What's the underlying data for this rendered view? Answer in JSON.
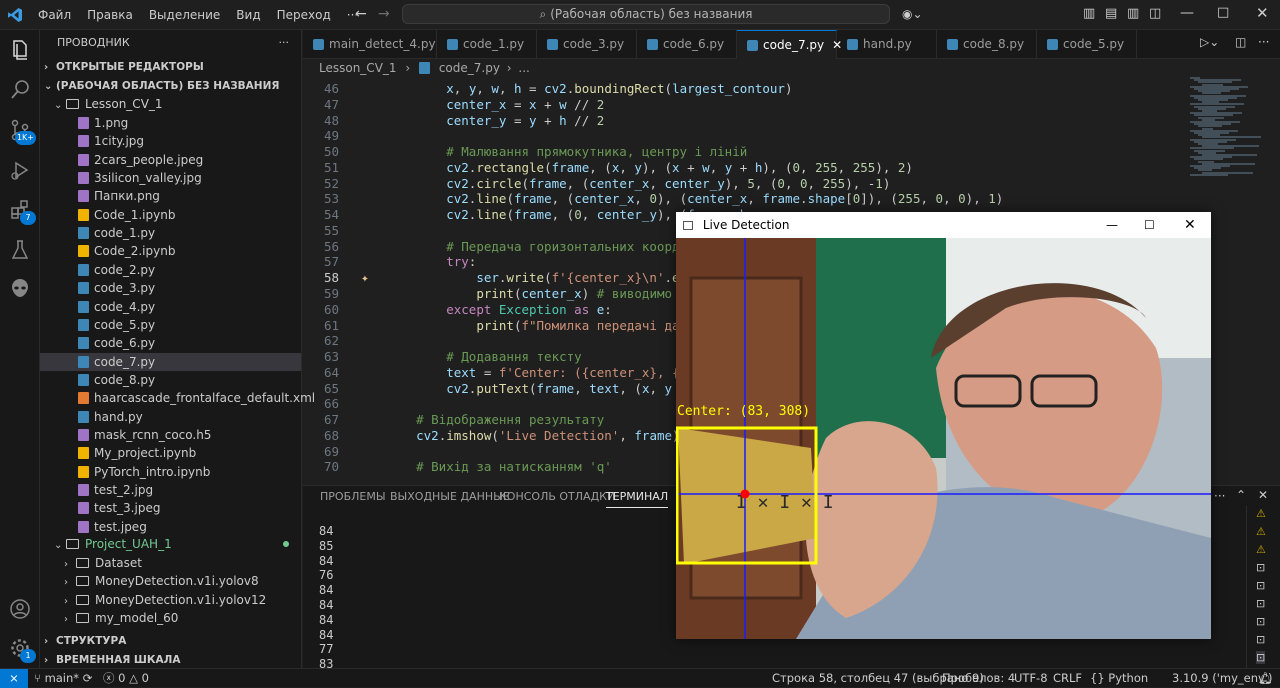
{
  "titlebar": {
    "menus": [
      "Файл",
      "Правка",
      "Выделение",
      "Вид",
      "Переход",
      "···"
    ],
    "search_text": "(Рабочая область) без названия"
  },
  "activity": {
    "badges": {
      "source_control": "1K+",
      "extensions": "7",
      "accounts": "1"
    }
  },
  "sidebar": {
    "title": "ПРОВОДНИК",
    "open_editors": "ОТКРЫТЫЕ РЕДАКТОРЫ",
    "workspace": "(РАБОЧАЯ ОБЛАСТЬ) БЕЗ НАЗВАНИЯ",
    "folder1": "Lesson_CV_1",
    "files": [
      "1.png",
      "1city.jpg",
      "2cars_people.jpeg",
      "3silicon_valley.jpg",
      "Папки.png",
      "Code_1.ipynb",
      "code_1.py",
      "Code_2.ipynb",
      "code_2.py",
      "code_3.py",
      "code_4.py",
      "code_5.py",
      "code_6.py",
      "code_7.py",
      "code_8.py",
      "haarcascade_frontalface_default.xml",
      "hand.py",
      "mask_rcnn_coco.h5",
      "My_project.ipynb",
      "PyTorch_intro.ipynb",
      "test_2.jpg",
      "test_3.jpeg",
      "test.jpeg"
    ],
    "folder2": "Project_UAH_1",
    "subfolders": [
      "Dataset",
      "MoneyDetection.v1i.yolov8",
      "MoneyDetection.v1i.yolov12",
      "my_model_60"
    ],
    "outline": "СТРУКТУРА",
    "timeline": "ВРЕМЕННАЯ ШКАЛА"
  },
  "tabs": [
    "main_detect_4.py",
    "code_1.py",
    "code_3.py",
    "code_6.py",
    "code_7.py",
    "hand.py",
    "code_8.py",
    "code_5.py"
  ],
  "active_tab": "code_7.py",
  "breadcrumb": {
    "folder": "Lesson_CV_1",
    "file": "code_7.py",
    "more": "..."
  },
  "code_lines": [
    {
      "n": "46",
      "text": "        x, y, w, h = cv2.boundingRect(largest_contour)"
    },
    {
      "n": "47",
      "text": "        center_x = x + w // 2"
    },
    {
      "n": "48",
      "text": "        center_y = y + h // 2"
    },
    {
      "n": "49",
      "text": ""
    },
    {
      "n": "50",
      "text": "        # Малювання прямокутника, центру і ліній"
    },
    {
      "n": "51",
      "text": "        cv2.rectangle(frame, (x, y), (x + w, y + h), (0, 255, 255), 2)"
    },
    {
      "n": "52",
      "text": "        cv2.circle(frame, (center_x, center_y), 5, (0, 0, 255), -1)"
    },
    {
      "n": "53",
      "text": "        cv2.line(frame, (center_x, 0), (center_x, frame.shape[0]), (255, 0, 0), 1)"
    },
    {
      "n": "54",
      "text": "        cv2.line(frame, (0, center_y), (frame.sha"
    },
    {
      "n": "55",
      "text": ""
    },
    {
      "n": "56",
      "text": "        # Передача горизонтальних координат у сер"
    },
    {
      "n": "57",
      "text": "        try:"
    },
    {
      "n": "58",
      "text": "            ser.write(f'{center_x}\\n'.encode())"
    },
    {
      "n": "59",
      "text": "            print(center_x) # виводимо координати"
    },
    {
      "n": "60",
      "text": "        except Exception as e:"
    },
    {
      "n": "61",
      "text": "            print(f\"Помилка передачі даних: {e}\")"
    },
    {
      "n": "62",
      "text": ""
    },
    {
      "n": "63",
      "text": "        # Додавання тексту"
    },
    {
      "n": "64",
      "text": "        text = f'Center: ({center_x}, {center_y})"
    },
    {
      "n": "65",
      "text": "        cv2.putText(frame, text, (x, y - 10), cv2"
    },
    {
      "n": "66",
      "text": ""
    },
    {
      "n": "67",
      "text": "    # Відображення результату"
    },
    {
      "n": "68",
      "text": "    cv2.imshow('Live Detection', frame)"
    },
    {
      "n": "69",
      "text": ""
    },
    {
      "n": "70",
      "text": "    # Вихід за натисканням 'q'"
    }
  ],
  "panel": {
    "tabs": [
      "ПРОБЛЕМЫ",
      "ВЫХОДНЫЕ ДАННЫЕ",
      "КОНСОЛЬ ОТЛАДКИ",
      "ТЕРМИНАЛ"
    ],
    "active": "ТЕРМИНАЛ",
    "terminal_lines": [
      "84",
      "85",
      "84",
      "76",
      "84",
      "84",
      "84",
      "84",
      "77",
      "83"
    ]
  },
  "status": {
    "branch": "main*",
    "problems_errors": "0",
    "problems_warnings": "0",
    "cursor": "Строка 58, столбец 47 (выбрано 9)",
    "spaces": "Пробелов: 4",
    "encoding": "UTF-8",
    "eol": "CRLF",
    "language": "Python",
    "interpreter": "3.10.9 ('my_env')"
  },
  "live_window": {
    "title": "Live Detection",
    "overlay_text": "Center: (83, 308)"
  }
}
